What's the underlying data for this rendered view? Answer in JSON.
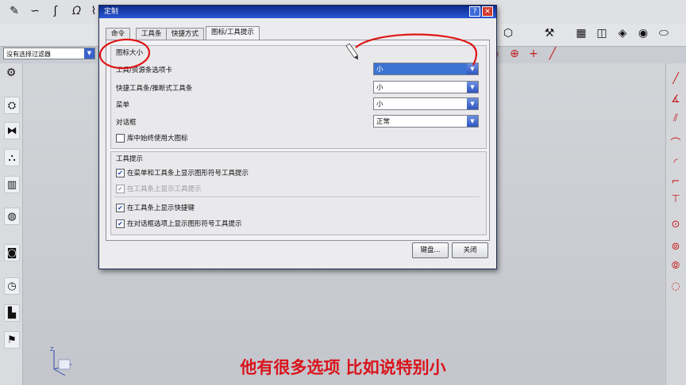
{
  "filter": {
    "value": "没有选择过滤器"
  },
  "dialog": {
    "title": "定制",
    "help_label": "?",
    "close_label": "✕",
    "tabs": [
      {
        "label": "命令"
      },
      {
        "label": "工具条"
      },
      {
        "label": "快捷方式"
      },
      {
        "label": "图标/工具提示"
      }
    ],
    "icon_size": {
      "group_title": "图标大小",
      "rows": [
        {
          "label": "工具/资源条选项卡",
          "value": "小"
        },
        {
          "label": "快捷工具条/推断式工具条",
          "value": "小"
        },
        {
          "label": "菜单",
          "value": "小"
        },
        {
          "label": "对话框",
          "value": "正常"
        }
      ],
      "checkbox_label": "库中始终使用大图标"
    },
    "tooltips": {
      "group_title": "工具提示",
      "checkboxes": [
        {
          "label": "在菜单和工具条上显示图形符号工具提示"
        },
        {
          "label": "在工具条上显示工具提示"
        },
        {
          "label": "在工具条上显示快捷键"
        },
        {
          "label": "在对话框选项上显示图形符号工具提示"
        }
      ]
    },
    "buttons": {
      "keyboard": "键盘...",
      "close": "关闭"
    }
  },
  "canvas": {
    "axis_label": "Z"
  },
  "subtitle": "他有很多选项 比如说特别小",
  "colors": {
    "accent": "#2a58d6",
    "annotation": "#d9141c",
    "subtitle": "#d9141c"
  }
}
